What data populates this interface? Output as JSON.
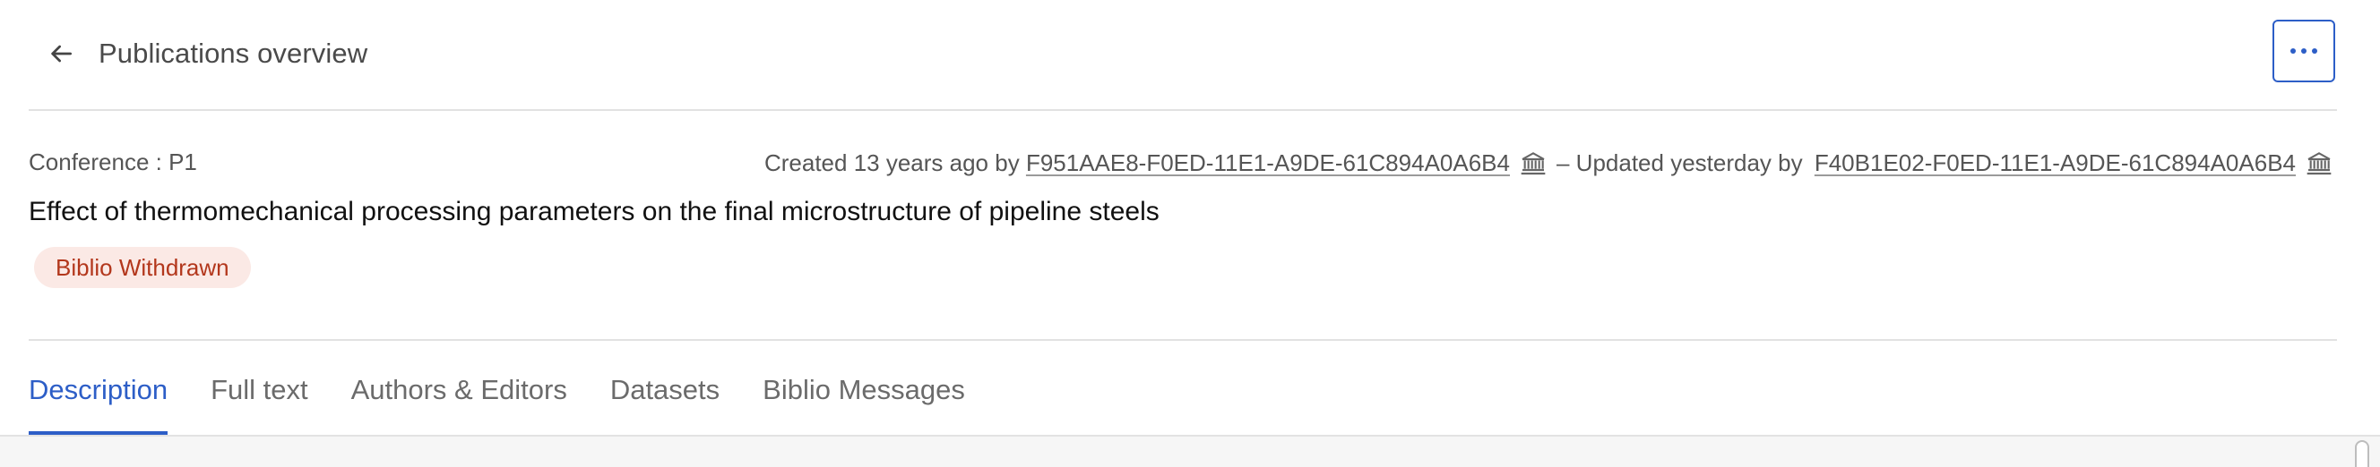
{
  "topbar": {
    "back_label": "Publications overview",
    "back_icon": "arrow-left-icon",
    "more_icon": "more-horizontal-icon"
  },
  "header": {
    "type_label": "Conference : P1",
    "created_prefix": "Created 13 years ago by",
    "created_by": "F951AAE8-F0ED-11E1-A9DE-61C894A0A6B4",
    "updated_prefix": "– Updated yesterday by",
    "updated_by": "F40B1E02-F0ED-11E1-A9DE-61C894A0A6B4",
    "institution_icon": "bank-icon",
    "title": "Effect of thermomechanical processing parameters on the final microstructure of pipeline steels",
    "status_badge": "Biblio Withdrawn"
  },
  "tabs": [
    {
      "label": "Description",
      "active": true
    },
    {
      "label": "Full text",
      "active": false
    },
    {
      "label": "Authors & Editors",
      "active": false
    },
    {
      "label": "Datasets",
      "active": false
    },
    {
      "label": "Biblio Messages",
      "active": false
    }
  ],
  "colors": {
    "accent": "#2d5ec7",
    "badge_bg": "#fbe9e5",
    "badge_text": "#b3371c"
  }
}
